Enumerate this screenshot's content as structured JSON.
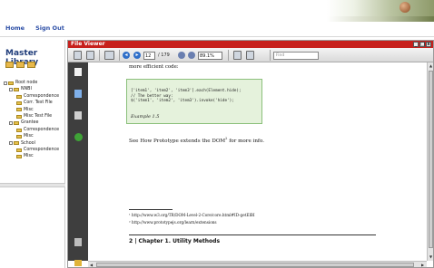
{
  "nav": {
    "home": "Home",
    "sign_out": "Sign Out"
  },
  "library": {
    "title": "Master Library",
    "tree": [
      {
        "label": "Root node",
        "depth": 1
      },
      {
        "label": "NNBI",
        "depth": 2
      },
      {
        "label": "Correspondence",
        "depth": 3
      },
      {
        "label": "Corr. Test File",
        "depth": 3
      },
      {
        "label": "Misc",
        "depth": 3
      },
      {
        "label": "Misc Test File",
        "depth": 3
      },
      {
        "label": "Grantee",
        "depth": 2
      },
      {
        "label": "Correspondence",
        "depth": 3
      },
      {
        "label": "Misc",
        "depth": 3
      },
      {
        "label": "School",
        "depth": 2
      },
      {
        "label": "Correspondence",
        "depth": 3
      },
      {
        "label": "Misc",
        "depth": 3
      }
    ]
  },
  "viewer": {
    "title": "File Viewer",
    "controls": [
      "_",
      "□",
      "x"
    ],
    "page_current": "12",
    "page_total": "/ 179",
    "zoom": "89.1%",
    "find_placeholder": "Find"
  },
  "document": {
    "intro": "more efficient code:",
    "code": "['item1', 'item2', 'item3'].each(Element.hide);\n// The better way:\n$('item1', 'item2', 'item3').invoke('hide');",
    "example": "Example 1.5",
    "see_line": "See How Prototype extends the DOM",
    "see_sup": "2",
    "see_end": " for more info.",
    "footnote1": "¹ http://www.w3.org/TR/DOM-Level-2-Core/core.html#ID-getElBI",
    "footnote2": "² http://www.prototypejs.org/learn/extensions",
    "chapter": "2 | Chapter 1. Utility Methods"
  },
  "colors": {
    "title_bar": "#c7201c",
    "nav_link": "#2c4ea6",
    "library_title": "#1f3c7a",
    "code_bg": "#e5f2dc",
    "sidebar": "#3e3e3e"
  }
}
